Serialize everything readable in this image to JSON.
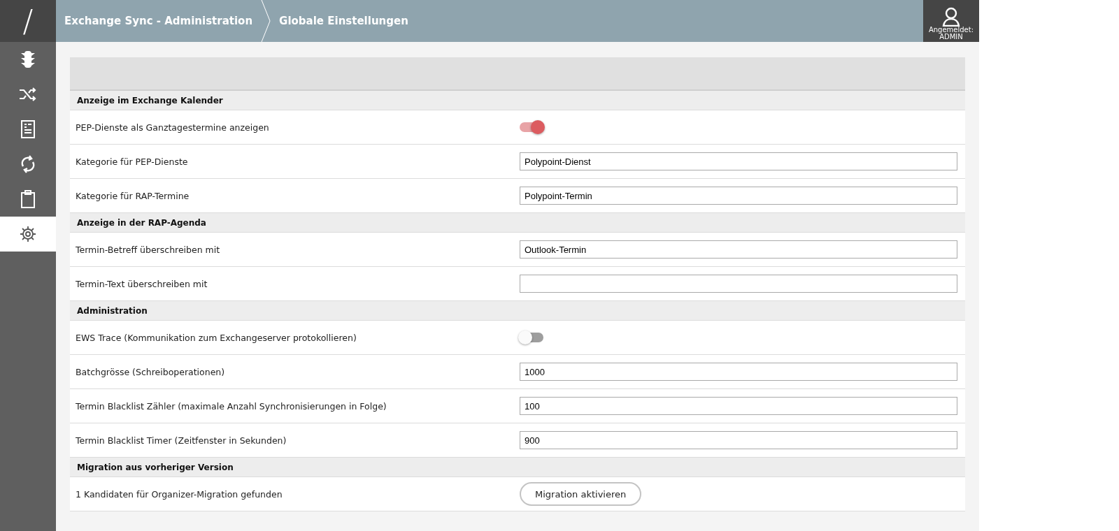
{
  "header": {
    "logo": "/",
    "breadcrumbs": [
      "Exchange Sync - Administration",
      "Globale Einstellungen"
    ],
    "user": {
      "label": "Angemeldet:",
      "name": "ADMIN"
    }
  },
  "sidebar": {
    "items": [
      {
        "selected": false
      },
      {
        "selected": false
      },
      {
        "selected": false
      },
      {
        "selected": false
      },
      {
        "selected": false
      },
      {
        "selected": true
      }
    ]
  },
  "sections": [
    {
      "title": "Anzeige im Exchange Kalender",
      "rows": [
        {
          "kind": "toggle",
          "label": "PEP-Dienste als Ganztagestermine anzeigen",
          "on": true
        },
        {
          "kind": "text",
          "label": "Kategorie für PEP-Dienste",
          "value": "Polypoint-Dienst"
        },
        {
          "kind": "text",
          "label": "Kategorie für RAP-Termine",
          "value": "Polypoint-Termin"
        }
      ]
    },
    {
      "title": "Anzeige in der RAP-Agenda",
      "rows": [
        {
          "kind": "text",
          "label": "Termin-Betreff überschreiben mit",
          "value": "Outlook-Termin"
        },
        {
          "kind": "text",
          "label": "Termin-Text überschreiben mit"
        }
      ]
    },
    {
      "title": "Administration",
      "rows": [
        {
          "kind": "toggle",
          "label": "EWS Trace (Kommunikation zum Exchangeserver protokollieren)",
          "on": false
        },
        {
          "kind": "text",
          "label": "Batchgrösse (Schreiboperationen)",
          "value": "1000"
        },
        {
          "kind": "text",
          "label": "Termin Blacklist Zähler (maximale Anzahl Synchronisierungen in Folge)",
          "value": "100"
        },
        {
          "kind": "text",
          "label": "Termin Blacklist Timer (Zeitfenster in Sekunden)",
          "value": "900"
        }
      ]
    },
    {
      "title": "Migration aus vorheriger Version",
      "rows": [
        {
          "kind": "button",
          "label": "1 Kandidaten für Organizer-Migration gefunden",
          "button": "Migration aktivieren"
        }
      ]
    }
  ]
}
